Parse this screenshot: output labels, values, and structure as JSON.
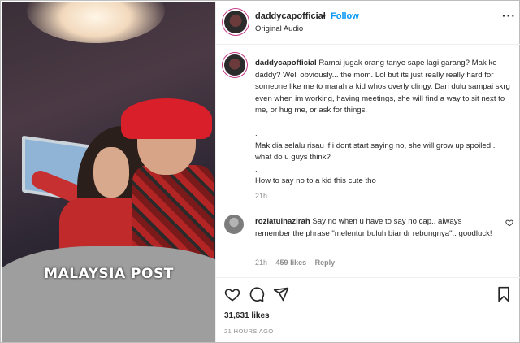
{
  "media": {
    "watermark": "MALAYSIA POST"
  },
  "header": {
    "username": "daddycapofficial",
    "separator": "•",
    "follow_label": "Follow",
    "subtitle": "Original Audio",
    "more_label": "···"
  },
  "caption": {
    "username": "daddycapofficial",
    "text": "Ramai jugak orang tanye sape lagi garang? Mak ke daddy? Well obviously... the mom. Lol but its just really really hard for someone like me to marah a kid whos overly clingy. Dari dulu sampai skrg even when im working, having meetings, she will find a way to sit next to me, or hug me, or ask for things.",
    "line_dot1": ".",
    "line_dot2": ".",
    "text2": "Mak dia selalu risau if i dont start saying no, she will grow up spoiled.. what do u guys think?",
    "line_dot3": ".",
    "text3": "How to say no to a kid this cute tho",
    "time": "21h"
  },
  "comment": {
    "username": "roziatulnazirah",
    "text": "Say no when u have to say no cap.. always remember the phrase \"melentur buluh biar dr rebungnya\".. goodluck!",
    "time": "21h",
    "likes": "459 likes",
    "reply_label": "Reply"
  },
  "actions": {
    "icons": [
      "heart-icon",
      "comment-icon",
      "share-icon",
      "bookmark-icon"
    ]
  },
  "stats": {
    "likes": "31,631 likes",
    "posted": "21 HOURS AGO"
  },
  "colors": {
    "follow": "#0095f6",
    "ring": "#c13584",
    "muted": "#8e8e8e"
  }
}
